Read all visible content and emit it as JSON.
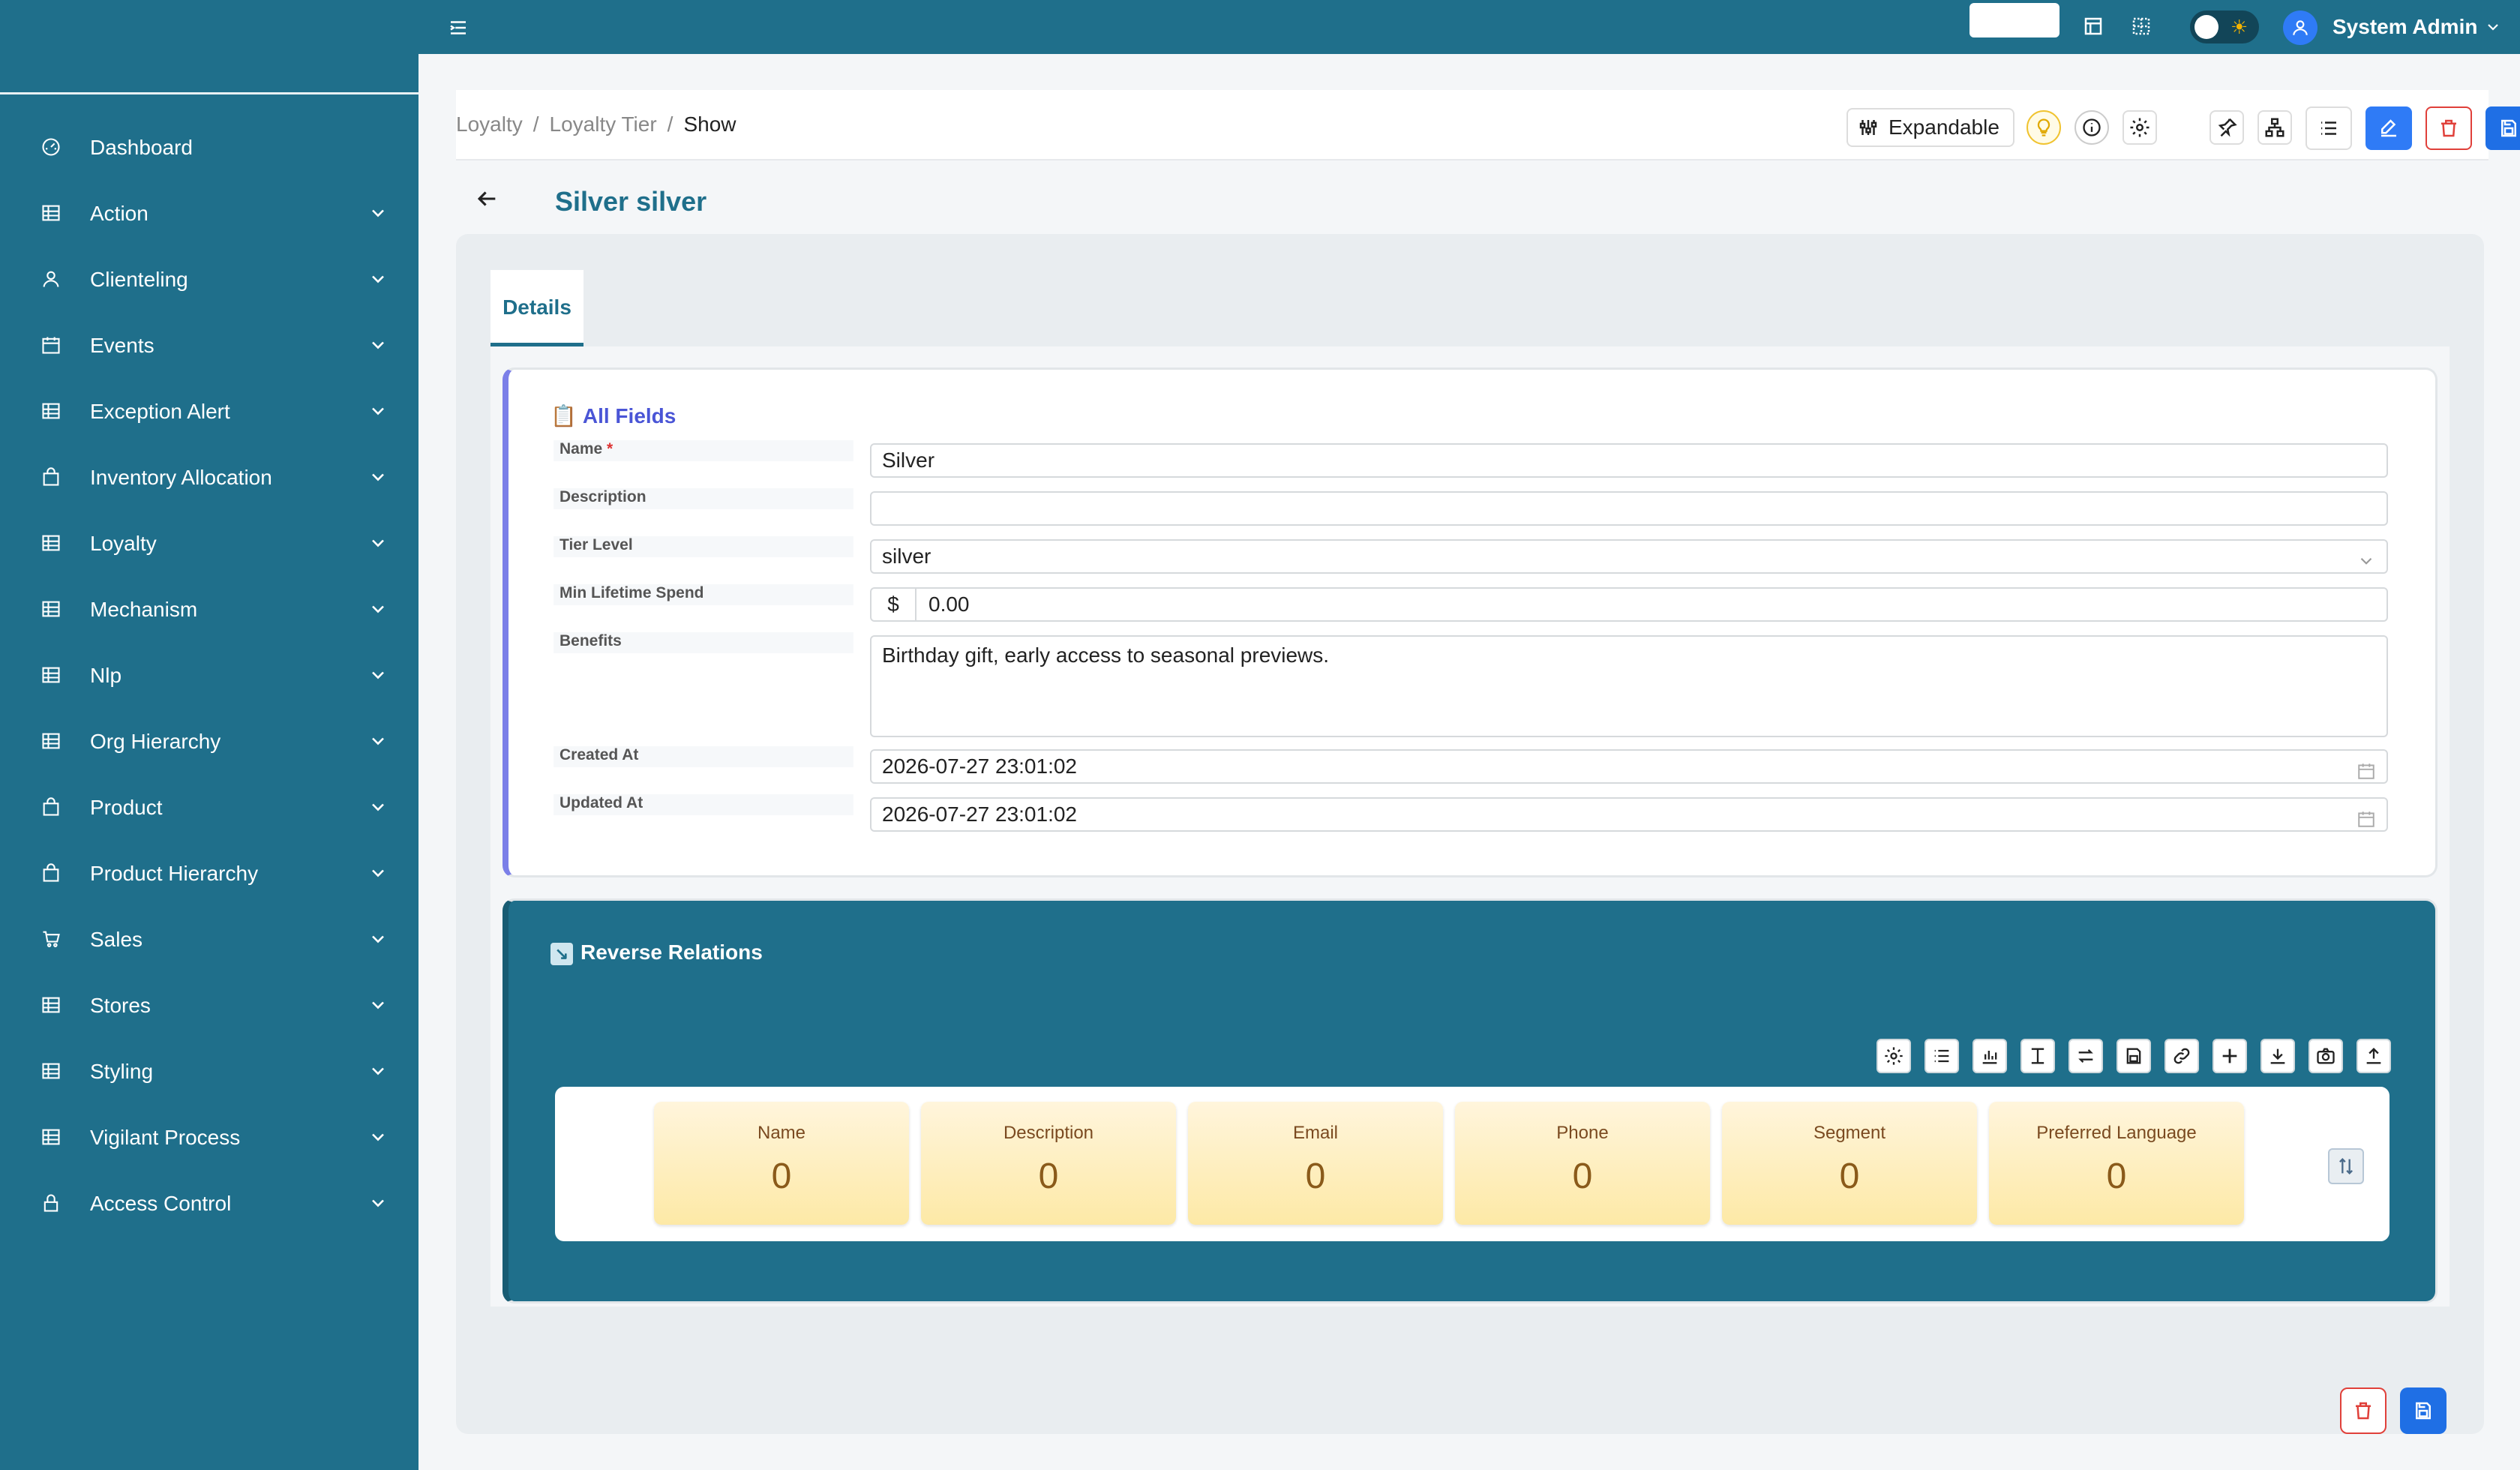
{
  "sidebar": {
    "items": [
      {
        "label": "Dashboard"
      },
      {
        "label": "Action"
      },
      {
        "label": "Clienteling"
      },
      {
        "label": "Events"
      },
      {
        "label": "Exception Alert"
      },
      {
        "label": "Inventory Allocation"
      },
      {
        "label": "Loyalty"
      },
      {
        "label": "Mechanism"
      },
      {
        "label": "Nlp"
      },
      {
        "label": "Org Hierarchy"
      },
      {
        "label": "Product"
      },
      {
        "label": "Product Hierarchy"
      },
      {
        "label": "Sales"
      },
      {
        "label": "Stores"
      },
      {
        "label": "Styling"
      },
      {
        "label": "Vigilant Process"
      },
      {
        "label": "Access Control"
      }
    ]
  },
  "topbar": {
    "user_name": "System Admin"
  },
  "breadcrumb": {
    "items": [
      "Loyalty",
      "Loyalty Tier",
      "Show"
    ],
    "separator": "/"
  },
  "toolbar": {
    "expandable_label": "Expandable"
  },
  "page": {
    "title": "Silver silver"
  },
  "tabs": [
    {
      "label": "Details"
    }
  ],
  "all_fields": {
    "icon": "📋",
    "title": "All Fields",
    "required_mark": "*",
    "fields": {
      "name": {
        "label": "Name",
        "value": "Silver"
      },
      "description": {
        "label": "Description",
        "value": ""
      },
      "tier_level": {
        "label": "Tier Level",
        "value": "silver"
      },
      "min_lifetime_spend": {
        "label": "Min Lifetime Spend",
        "prefix": "$",
        "value": "0.00"
      },
      "benefits": {
        "label": "Benefits",
        "value": "Birthday gift, early access to seasonal previews."
      },
      "created_at": {
        "label": "Created At",
        "value": "2026-07-27 23:01:02"
      },
      "updated_at": {
        "label": "Updated At",
        "value": "2026-07-27 23:01:02"
      }
    }
  },
  "reverse_relations": {
    "icon": "↘",
    "title": "Reverse Relations",
    "stats": [
      {
        "label": "Name",
        "value": "0"
      },
      {
        "label": "Description",
        "value": "0"
      },
      {
        "label": "Email",
        "value": "0"
      },
      {
        "label": "Phone",
        "value": "0"
      },
      {
        "label": "Segment",
        "value": "0"
      },
      {
        "label": "Preferred Language",
        "value": "0"
      }
    ]
  },
  "colors": {
    "primary": "#1f6f8b",
    "accent_blue": "#2f7bf6",
    "danger": "#e0403a",
    "indigo": "#4a55d6"
  }
}
